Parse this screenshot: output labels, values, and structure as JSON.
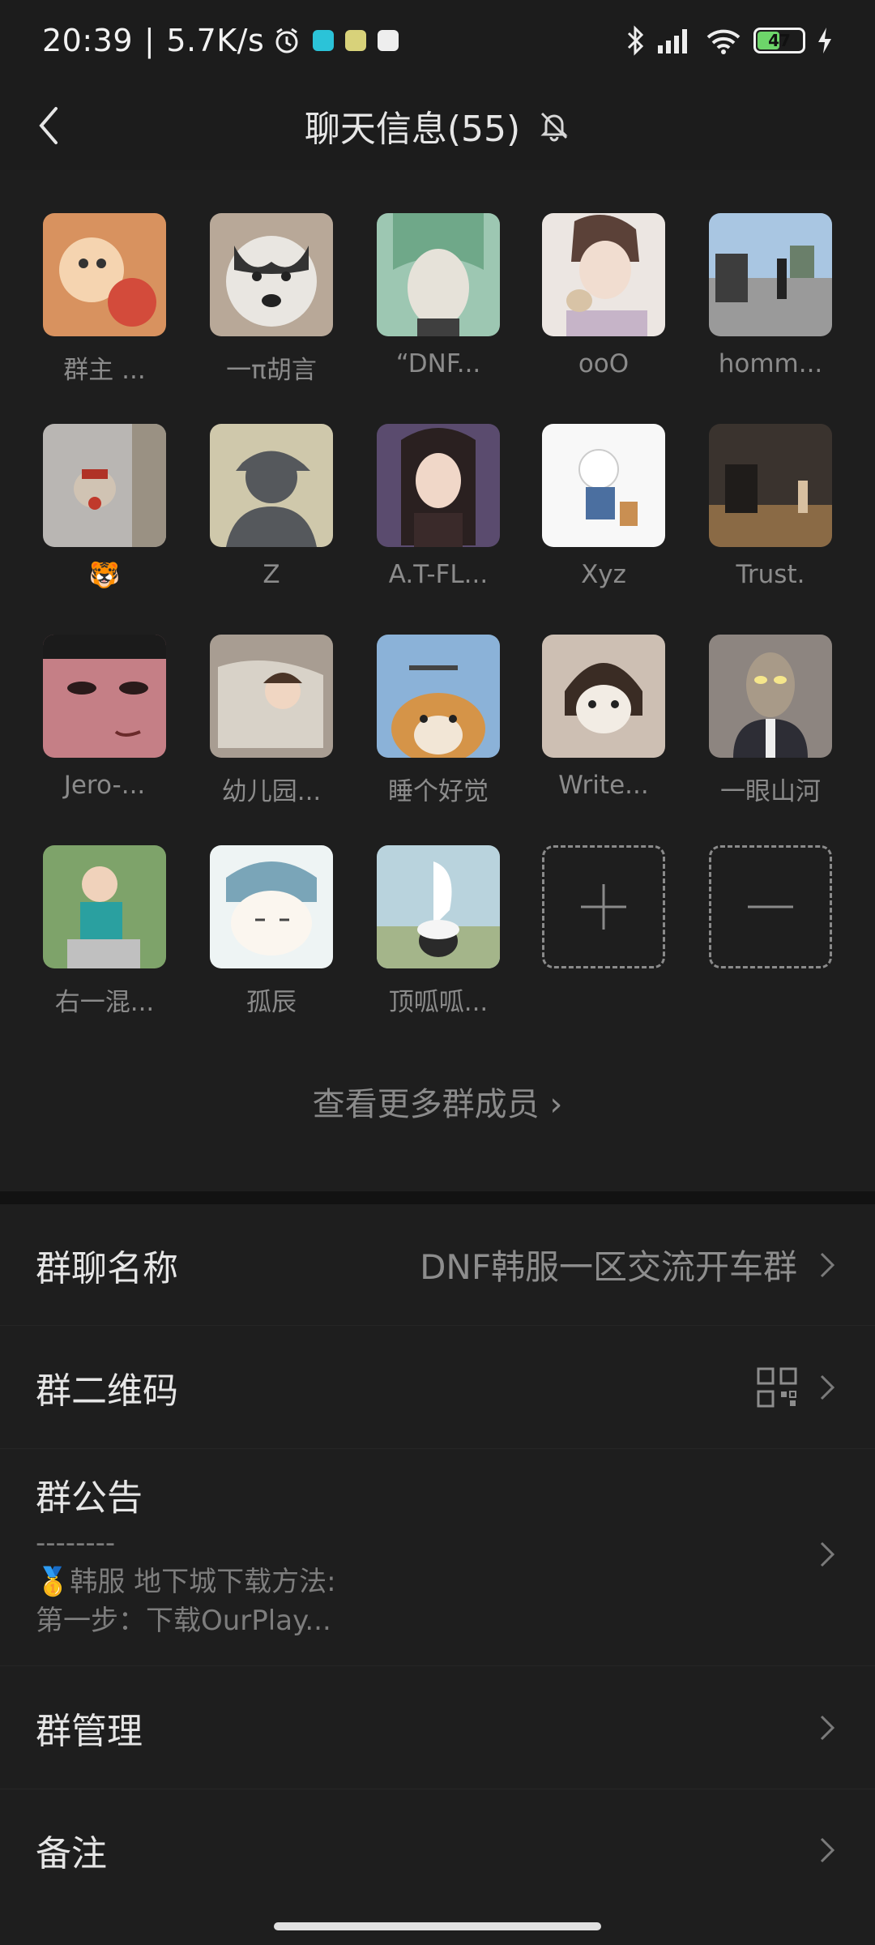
{
  "status_bar": {
    "time": "20:39",
    "speed": "5.7K/s",
    "battery": "47"
  },
  "header": {
    "title": "聊天信息(55)"
  },
  "members": [
    {
      "name": "群主 ...",
      "color": "#e6a26e"
    },
    {
      "name": "一π胡言",
      "color": "#9b8a78"
    },
    {
      "name": "“DNF...",
      "color": "#8fb9a4"
    },
    {
      "name": "ooO",
      "color": "#d8ccc6"
    },
    {
      "name": "homm...",
      "color": "#8ea4b8"
    },
    {
      "name": "🐯",
      "color": "#b7b2ae"
    },
    {
      "name": "Z",
      "color": "#c9c2a9"
    },
    {
      "name": "A.T-FL...",
      "color": "#6c5a5e"
    },
    {
      "name": "Xyz",
      "color": "#f1f1f1"
    },
    {
      "name": "Trust.",
      "color": "#5a4a40"
    },
    {
      "name": "Jero-...",
      "color": "#c57f86"
    },
    {
      "name": "幼儿园...",
      "color": "#a89d92"
    },
    {
      "name": "睡个好觉",
      "color": "#8bb2d8"
    },
    {
      "name": "Write...",
      "color": "#cdbfb3"
    },
    {
      "name": "一眼山河",
      "color": "#8d8580"
    },
    {
      "name": "右一混...",
      "color": "#7ea36a"
    },
    {
      "name": "孤辰",
      "color": "#ece7de"
    },
    {
      "name": "顶呱呱...",
      "color": "#b9c9b4"
    }
  ],
  "more_members_label": "查看更多群成员 ›",
  "rows": {
    "group_name_label": "群聊名称",
    "group_name_value": "DNF韩服一区交流开车群",
    "qr_label": "群二维码",
    "announcement_label": "群公告",
    "announcement_line0": "--------",
    "announcement_line1": "🥇韩服 地下城下载方法:",
    "announcement_line2": "第一步：下载OurPlay...",
    "manage_label": "群管理",
    "remark_label": "备注"
  }
}
